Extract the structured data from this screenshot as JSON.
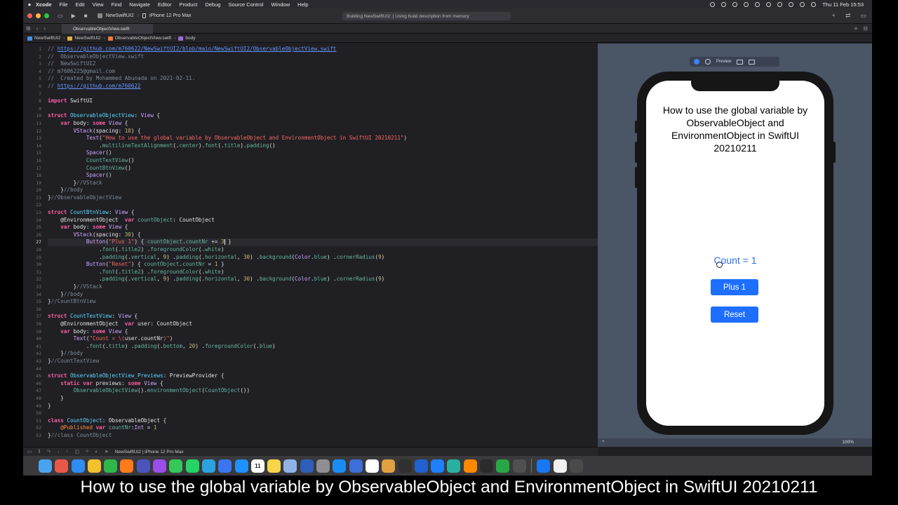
{
  "menubar": {
    "apple": "",
    "items": [
      "Xcode",
      "File",
      "Edit",
      "View",
      "Find",
      "Navigate",
      "Editor",
      "Product",
      "Debug",
      "Source Control",
      "Window",
      "Help"
    ],
    "clock": "Thu 11 Feb  15:53"
  },
  "toolbar": {
    "scheme": "NewSwiftUI2",
    "device": "iPhone 12 Pro Max",
    "activity": "Building NewSwiftUI2: | Using build description from memory"
  },
  "tab": {
    "label": "ObservableObjectView.swift"
  },
  "jumpbar": {
    "crumbs": [
      "NewSwiftUI2",
      "NewSwiftUI2",
      "ObservableObjectView.swift",
      "body"
    ]
  },
  "editor": {
    "line_numbers": [
      "1",
      "2",
      "3",
      "4",
      "5",
      "6",
      "7",
      "8",
      "9",
      "10",
      "11",
      "12",
      "13",
      "14",
      "15",
      "16",
      "17",
      "18",
      "19",
      "20",
      "21",
      "22",
      "23",
      "24",
      "25",
      "26",
      "27",
      "28",
      "29",
      "30",
      "31",
      "32",
      "33",
      "34",
      "35",
      "36",
      "37",
      "38",
      "39",
      "40",
      "41",
      "42",
      "43",
      "44",
      "45",
      "46",
      "47",
      "48",
      "49",
      "50",
      "51",
      "52",
      "53"
    ],
    "current_line": 27
  },
  "canvas": {
    "preview_label": "Preview",
    "zoom": "100%"
  },
  "preview": {
    "title": "How to use the global variable by ObservableObject and EnvironmentObject in SwiftUI 20210211",
    "count_text": "Count = 1",
    "plus_button": "Plus 1",
    "reset_button": "Reset"
  },
  "debugbar": {
    "target": "NewSwiftUI2 | iPhone 12 Pro Max"
  },
  "dock": {
    "apps": [
      "finder",
      "launchpad",
      "safari",
      "chrome",
      "facetime",
      "firefox",
      "teams",
      "podcasts",
      "messages",
      "whatsapp",
      "telegram",
      "signal",
      "app-store-alt",
      "calendar",
      "notes",
      "preview",
      "xcode-instruments",
      "system-preferences",
      "app-store",
      "simulator",
      "compass",
      "photos",
      "obs",
      "vpn",
      "shazam",
      "network",
      "vlc",
      "activity-monitor",
      "numbers",
      "help",
      "xcode",
      "textedit",
      "simulator-2"
    ],
    "calendar_day": "11"
  },
  "caption": "How to use the global variable by ObservableObject and EnvironmentObject in SwiftUI 20210211"
}
